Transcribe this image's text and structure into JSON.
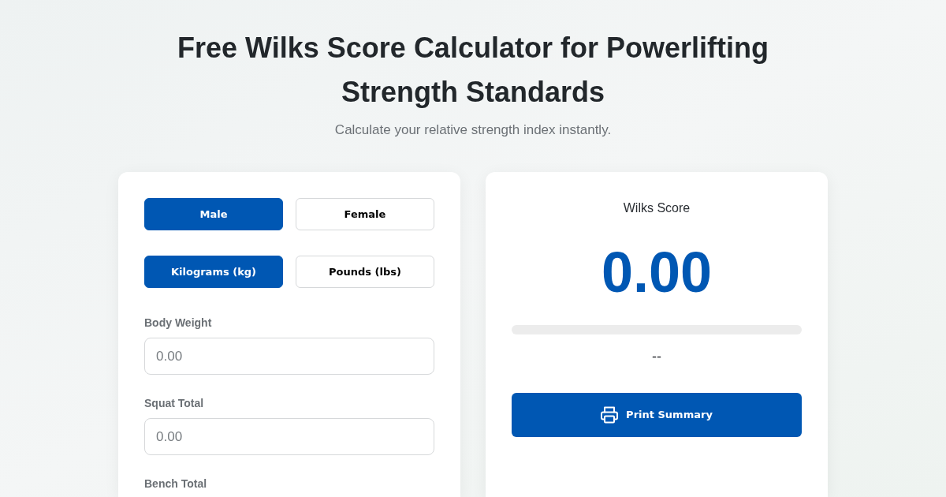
{
  "header": {
    "title": "Free Wilks Score Calculator for Powerlifting Strength Standards",
    "subtitle": "Calculate your relative strength index instantly."
  },
  "calculator": {
    "gender_options": [
      {
        "label": "Male",
        "selected": true
      },
      {
        "label": "Female",
        "selected": false
      }
    ],
    "unit_options": [
      {
        "label": "Kilograms (kg)",
        "selected": true
      },
      {
        "label": "Pounds (lbs)",
        "selected": false
      }
    ],
    "fields": [
      {
        "label": "Body Weight",
        "placeholder": "0.00"
      },
      {
        "label": "Squat Total",
        "placeholder": "0.00"
      },
      {
        "label": "Bench Total"
      }
    ]
  },
  "result": {
    "title": "Wilks Score",
    "score": "0.00",
    "level": 0,
    "rating": "--",
    "print_button": "Print Summary"
  }
}
